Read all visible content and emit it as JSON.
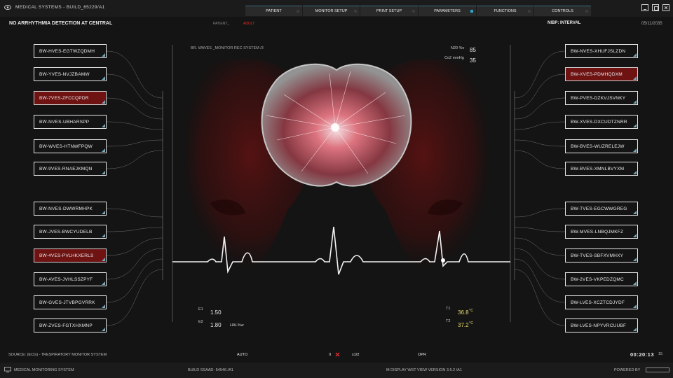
{
  "titlebar": {
    "app_title": "MEDICAL SYSTEMS - BUILD_65229/A1",
    "tabs": [
      {
        "label": "PATIENT",
        "active": false
      },
      {
        "label": "MONITOR SETUP",
        "active": false
      },
      {
        "label": "PRINT SETUP",
        "active": false
      },
      {
        "label": "PARAMETERS",
        "active": true
      },
      {
        "label": "FUNCTIONS",
        "active": false
      },
      {
        "label": "CONTROLS",
        "active": false
      }
    ]
  },
  "header": {
    "alarm_text": "NO ARRHYTHMIA DETECTION AT CENTRAL",
    "patient_label": "PATIENT_",
    "patient_type": "ADULT",
    "nibp": "NIBP: INTERVAL",
    "date": "05/11/2035"
  },
  "left_labels": [
    {
      "text": "BW-HVES-EGTWZQDMH",
      "highlight": false
    },
    {
      "text": "BW-YVES-NVJZBAMW",
      "highlight": false
    },
    {
      "text": "BW-7VES-ZFCCQPDR",
      "highlight": true
    },
    {
      "text": "BW-NVES-UBHARSPP",
      "highlight": false
    },
    {
      "text": "BW-WVES-HTNWFPQW",
      "highlight": false
    },
    {
      "text": "BW-9VES-RNAEJKMQN",
      "highlight": false
    },
    {
      "text": "BW-NVES-DWWRMHPK",
      "highlight": false
    },
    {
      "text": "BW-JVES-BWCYUDELB",
      "highlight": false
    },
    {
      "text": "BW-4VES-PVLHKXERLS",
      "highlight": true
    },
    {
      "text": "BW-AVES-JVHLSSZPYF",
      "highlight": false
    },
    {
      "text": "BW-GVES-JTVBPGVRRK",
      "highlight": false
    },
    {
      "text": "BW-ZVES-FGTXHXMNP",
      "highlight": false
    }
  ],
  "right_labels": [
    {
      "text": "BW-NVES-XHUFJSLZDN",
      "highlight": false
    },
    {
      "text": "BW-XVES-PDMHQDXM",
      "highlight": true
    },
    {
      "text": "BW-PVES-DZKVJSVNKY",
      "highlight": false
    },
    {
      "text": "BW-XVES-DXCUDTZNRR",
      "highlight": false
    },
    {
      "text": "BW-BVES-WUZRELEJW",
      "highlight": false
    },
    {
      "text": "BW-BVES-XMNLBVYXM",
      "highlight": false
    },
    {
      "text": "BW-TVES-EGCWWGREG",
      "highlight": false
    },
    {
      "text": "BW-MVES-LNBQJMKFZ",
      "highlight": false
    },
    {
      "text": "BW-TVES-SBFXVMHXY",
      "highlight": false
    },
    {
      "text": "BW-2VES-VKPEDZQMC",
      "highlight": false
    },
    {
      "text": "BW-LVES-XCZTCDJYDF",
      "highlight": false
    },
    {
      "text": "BW-LVES-NPYVRCUUBF",
      "highlight": false
    }
  ],
  "center": {
    "caption": "BR. WAVES _MONITOR REC SYSTEM /3",
    "n2o_label": "N20 %v",
    "n2o_value": "85",
    "co2_label": "Co2 mmHg",
    "co2_value": "35",
    "e1_label": "E1",
    "e1_value": "1.50",
    "e2_label": "E2",
    "e2_value": "1.80",
    "hal_label": "HAL%w",
    "t1_label": "T1",
    "t1_value": "36.8",
    "t1_unit": "°C",
    "t2_label": "T2",
    "t2_value": "37.2",
    "t2_unit": "°C"
  },
  "bottom_bar": {
    "source": "SOURCE: (ECG) - T",
    "resp": "RESPIRATORY MONITOR SYSTEM",
    "auto": "AUTO",
    "pause": "II",
    "speed": "x1/2",
    "opr": "OPR",
    "timer": "00:20:13",
    "timer_frac": "15"
  },
  "status_bar": {
    "left": "MEDICAL MONITORING SYSTEM",
    "build": "BUILD SSAAD- 54546 /A1",
    "version": "M DISPLAY WST VIEW  VERSION 3.5.2 /A1",
    "powered": "POWERED BY"
  },
  "colors": {
    "accent": "#2fa6c8",
    "alarm_red": "#6e1212",
    "temp_yellow": "#e4dc6a"
  }
}
